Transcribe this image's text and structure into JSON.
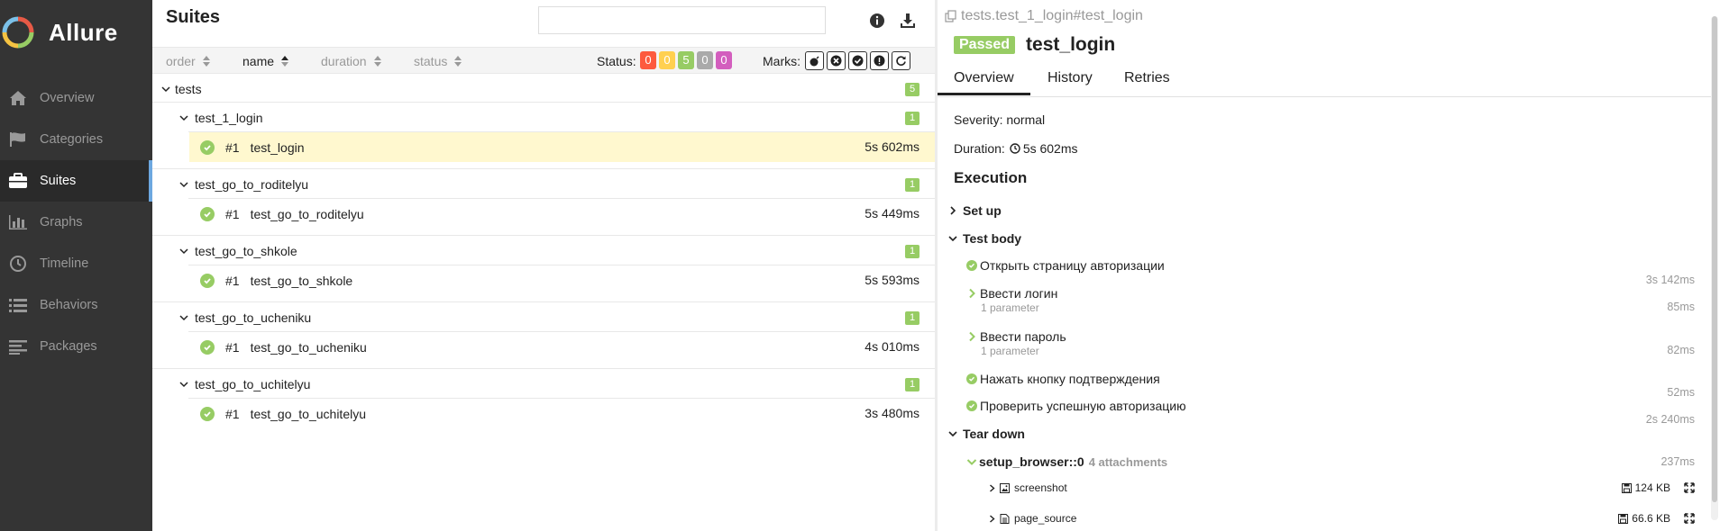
{
  "brand": {
    "name": "Allure"
  },
  "sidebar": {
    "items": [
      {
        "label": "Overview",
        "icon": "home-icon"
      },
      {
        "label": "Categories",
        "icon": "flag-icon"
      },
      {
        "label": "Suites",
        "icon": "briefcase-icon",
        "active": true
      },
      {
        "label": "Graphs",
        "icon": "bar-chart-icon"
      },
      {
        "label": "Timeline",
        "icon": "clock-icon"
      },
      {
        "label": "Behaviors",
        "icon": "list-icon"
      },
      {
        "label": "Packages",
        "icon": "align-left-icon"
      }
    ]
  },
  "suites": {
    "title": "Suites",
    "search": {
      "value": "",
      "placeholder": ""
    },
    "sort": {
      "order": "order",
      "name": "name",
      "duration": "duration",
      "status": "status"
    },
    "status_label": "Status:",
    "status_counts": [
      {
        "value": "0",
        "color": "#fd5a3e"
      },
      {
        "value": "0",
        "color": "#ffd050"
      },
      {
        "value": "5",
        "color": "#97cc64"
      },
      {
        "value": "0",
        "color": "#aaaaaa"
      },
      {
        "value": "0",
        "color": "#d35ebe"
      }
    ],
    "marks_label": "Marks:",
    "root": {
      "name": "tests",
      "count": "5"
    },
    "groups": [
      {
        "name": "test_1_login",
        "count": "1",
        "case": {
          "num": "#1",
          "name": "test_login",
          "duration": "5s 602ms"
        },
        "selected": true
      },
      {
        "name": "test_go_to_roditelyu",
        "count": "1",
        "case": {
          "num": "#1",
          "name": "test_go_to_roditelyu",
          "duration": "5s 449ms"
        }
      },
      {
        "name": "test_go_to_shkole",
        "count": "1",
        "case": {
          "num": "#1",
          "name": "test_go_to_shkole",
          "duration": "5s 593ms"
        }
      },
      {
        "name": "test_go_to_ucheniku",
        "count": "1",
        "case": {
          "num": "#1",
          "name": "test_go_to_ucheniku",
          "duration": "4s 010ms"
        }
      },
      {
        "name": "test_go_to_uchitelyu",
        "count": "1",
        "case": {
          "num": "#1",
          "name": "test_go_to_uchitelyu",
          "duration": "3s 480ms"
        }
      }
    ]
  },
  "detail": {
    "breadcrumb": "tests.test_1_login#test_login",
    "status": "Passed",
    "title": "test_login",
    "tabs": [
      "Overview",
      "History",
      "Retries"
    ],
    "severity": "Severity: normal",
    "duration_label": "Duration:",
    "duration": "5s 602ms",
    "execution": "Execution",
    "setup": "Set up",
    "test_body": "Test body",
    "steps": [
      {
        "name": "Открыть страницу авторизации",
        "duration": "3s 142ms"
      },
      {
        "name": "Ввести логин",
        "sub": "1 parameter",
        "duration": "85ms"
      },
      {
        "name": "Ввести пароль",
        "sub": "1 parameter",
        "duration": "82ms"
      },
      {
        "name": "Нажать кнопку подтверждения",
        "duration": "52ms"
      },
      {
        "name": "Проверить успешную авторизацию",
        "duration": "2s 240ms"
      }
    ],
    "teardown": "Tear down",
    "fixture": {
      "name": "setup_browser::0",
      "attachments": "4 attachments",
      "duration": "237ms"
    },
    "attachments": [
      {
        "name": "screenshot",
        "size": "124 KB"
      },
      {
        "name": "page_source",
        "size": "66.6 KB"
      }
    ]
  }
}
